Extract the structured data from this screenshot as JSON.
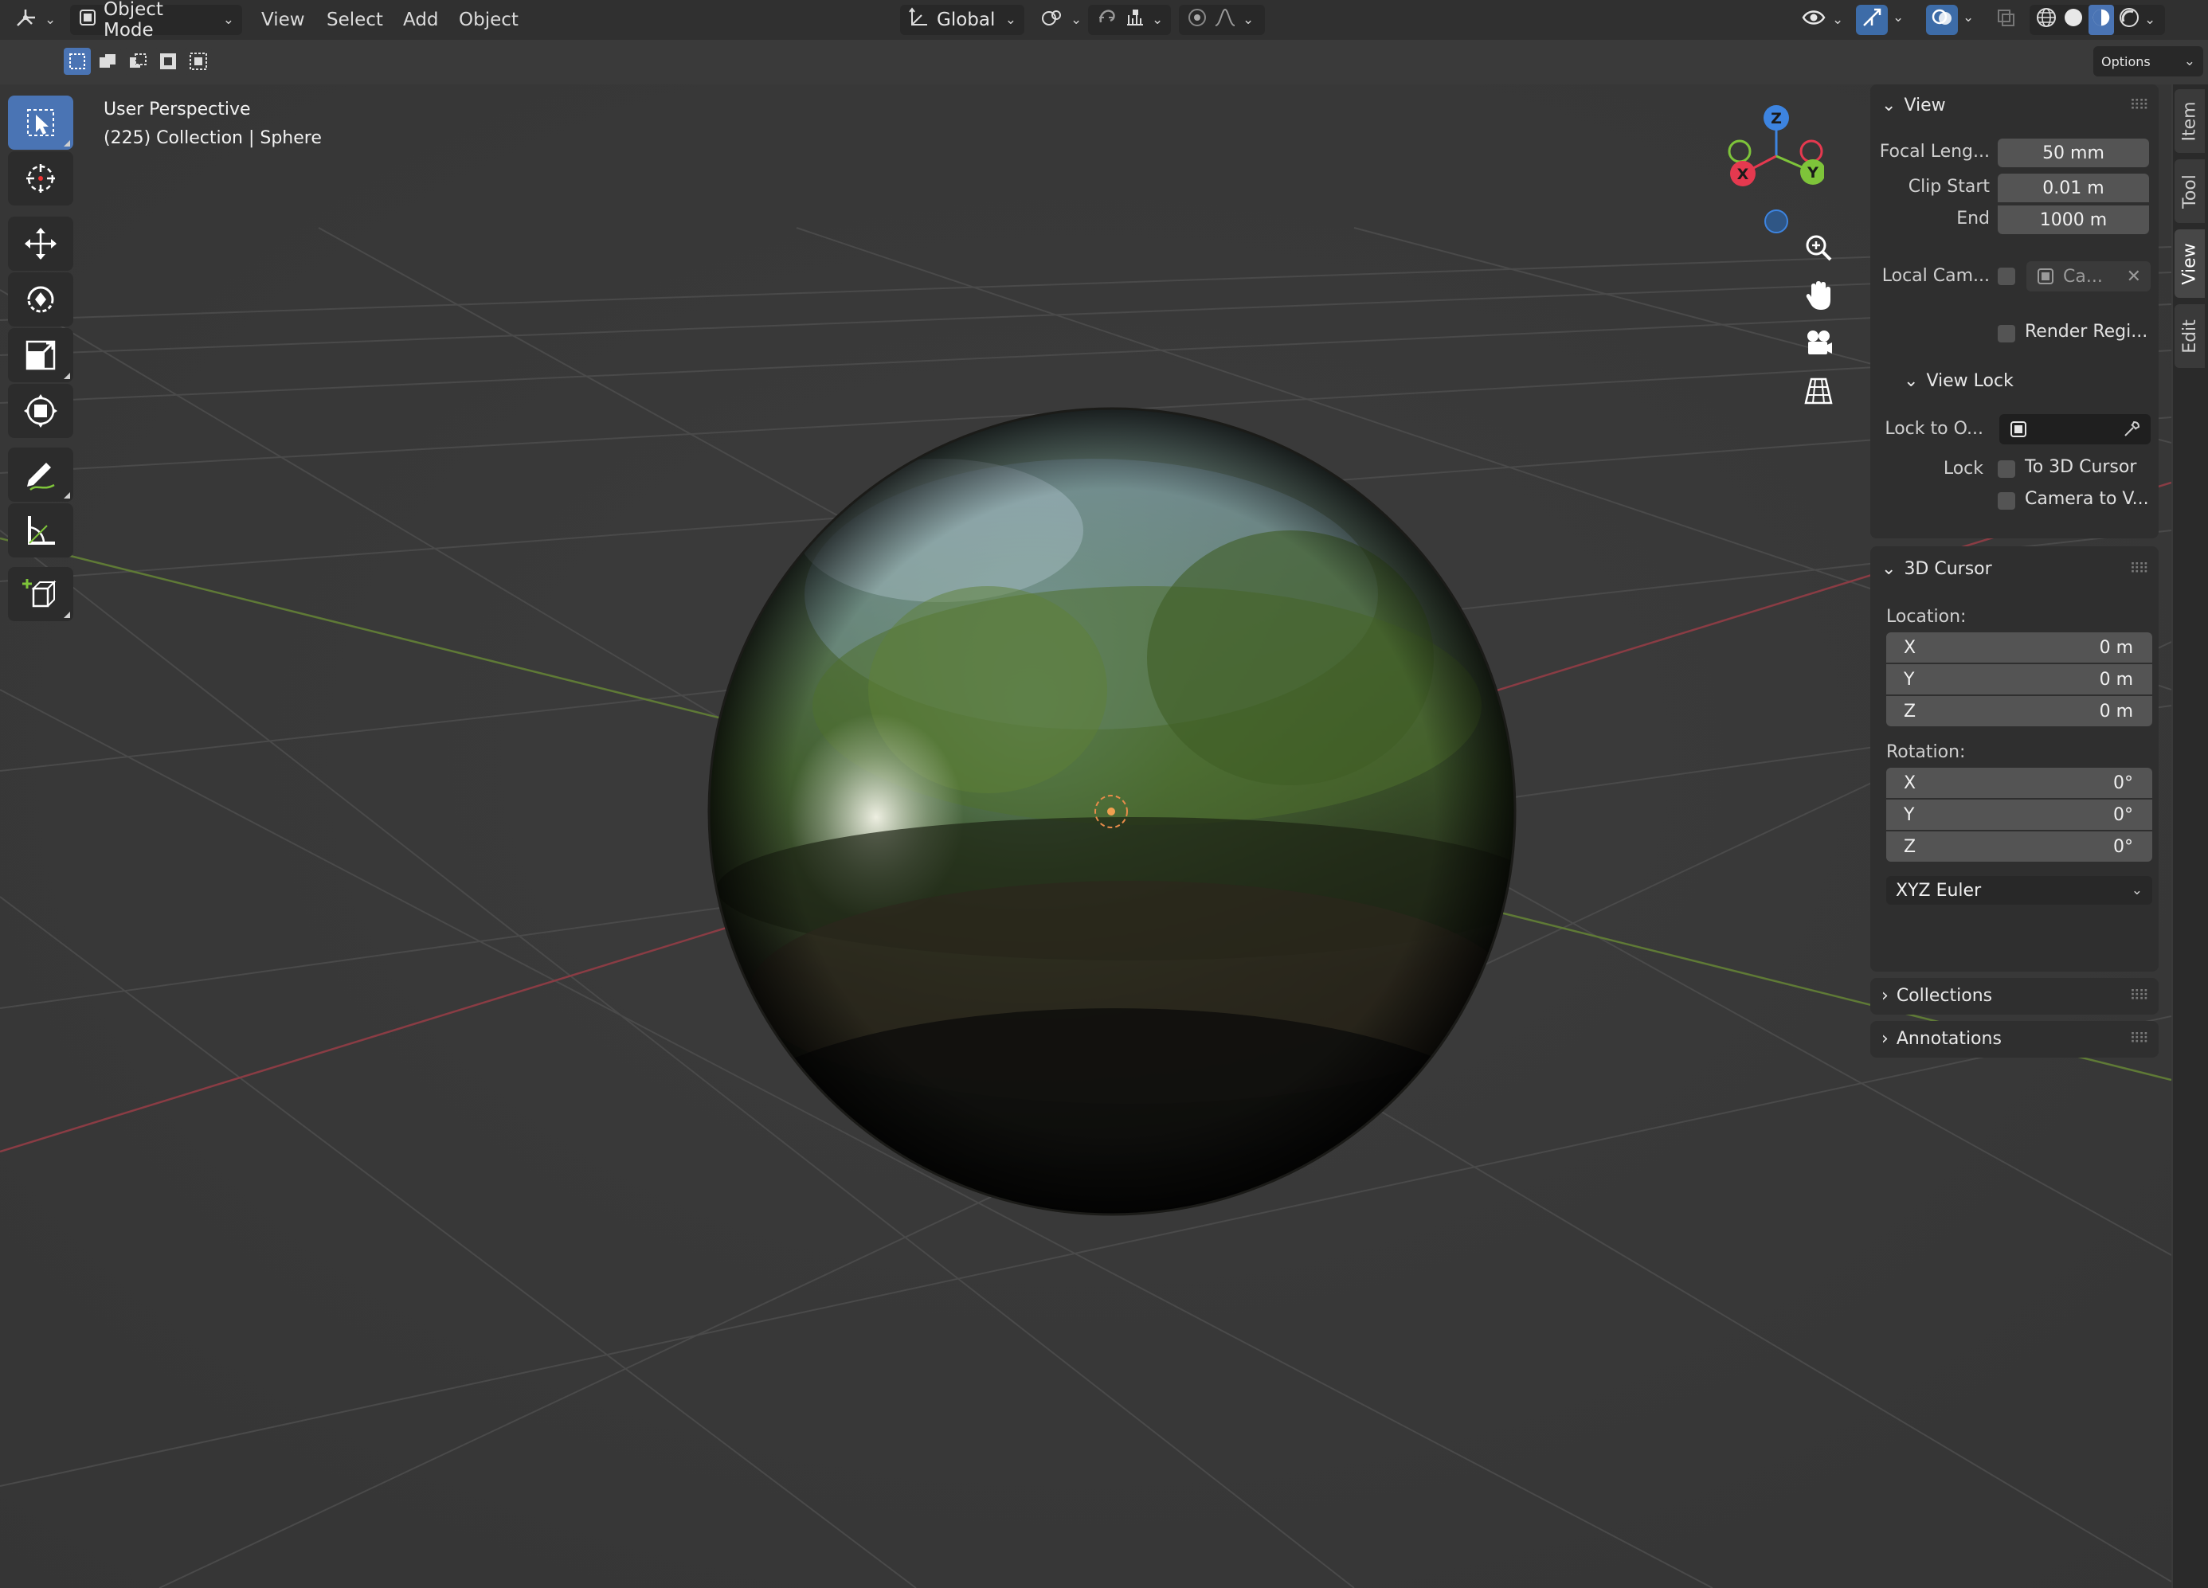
{
  "header": {
    "mode_label": "Object Mode",
    "menus": [
      "View",
      "Select",
      "Add",
      "Object"
    ],
    "orientation_label": "Global",
    "options_label": "Options"
  },
  "viewport": {
    "view_name": "User Perspective",
    "collection_info": "(225) Collection | Sphere"
  },
  "gizmo": {
    "x": "X",
    "y": "Y",
    "z": "Z"
  },
  "sidebar": {
    "view_panel": {
      "title": "View",
      "focal_length_label": "Focal Leng...",
      "focal_length_value": "50 mm",
      "clip_start_label": "Clip Start",
      "clip_start_value": "0.01 m",
      "end_label": "End",
      "end_value": "1000 m",
      "local_camera_label": "Local Cam...",
      "local_camera_value": "Ca...",
      "render_region_label": "Render Regi...",
      "view_lock_title": "View Lock",
      "lock_to_object_label": "Lock to O...",
      "lock_label": "Lock",
      "to_3d_cursor_label": "To 3D Cursor",
      "camera_to_view_label": "Camera to V..."
    },
    "cursor_panel": {
      "title": "3D Cursor",
      "location_label": "Location:",
      "location": [
        {
          "axis": "X",
          "value": "0 m"
        },
        {
          "axis": "Y",
          "value": "0 m"
        },
        {
          "axis": "Z",
          "value": "0 m"
        }
      ],
      "rotation_label": "Rotation:",
      "rotation": [
        {
          "axis": "X",
          "value": "0°"
        },
        {
          "axis": "Y",
          "value": "0°"
        },
        {
          "axis": "Z",
          "value": "0°"
        }
      ],
      "rotation_mode": "XYZ Euler"
    },
    "collections_title": "Collections",
    "annotations_title": "Annotations"
  },
  "side_tabs": [
    "Item",
    "Tool",
    "View",
    "Edit"
  ],
  "colors": {
    "accent": "#4a74b4",
    "axis_x": "#e5394f",
    "axis_y": "#7ec43a",
    "axis_z": "#3d84e0"
  }
}
